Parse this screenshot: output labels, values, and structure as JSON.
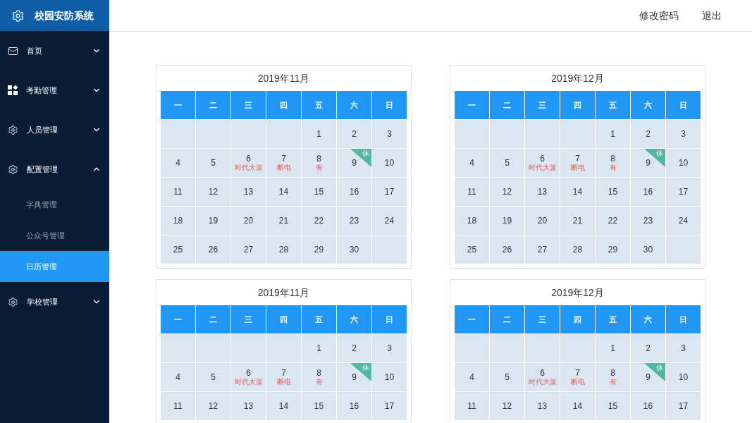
{
  "app": {
    "title": "校园安防系统"
  },
  "header": {
    "links": [
      "修改密码",
      "退出"
    ]
  },
  "sidebar": {
    "items": [
      {
        "label": "首页",
        "expanded": false
      },
      {
        "label": "考勤管理",
        "expanded": false
      },
      {
        "label": "人员管理",
        "expanded": false
      },
      {
        "label": "配置管理",
        "expanded": true,
        "children": [
          {
            "label": "字典管理",
            "selected": false
          },
          {
            "label": "公众号管理",
            "selected": false
          },
          {
            "label": "日历管理",
            "selected": true
          }
        ]
      },
      {
        "label": "学校管理",
        "expanded": false
      }
    ]
  },
  "calendars": [
    {
      "title": "2019年11月",
      "weekdays": [
        "一",
        "二",
        "三",
        "四",
        "五",
        "六",
        "日"
      ],
      "weeks": [
        [
          {
            "kind": "blank"
          },
          {
            "kind": "blank"
          },
          {
            "kind": "blank"
          },
          {
            "kind": "blank"
          },
          {
            "kind": "day",
            "day": "1"
          },
          {
            "kind": "day",
            "day": "2"
          },
          {
            "kind": "day",
            "day": "3"
          }
        ],
        [
          {
            "kind": "day",
            "day": "4"
          },
          {
            "kind": "day",
            "day": "5"
          },
          {
            "kind": "day",
            "day": "6",
            "note": "时代大厦"
          },
          {
            "kind": "day",
            "day": "7",
            "note": "断电"
          },
          {
            "kind": "day",
            "day": "8",
            "note": "有"
          },
          {
            "kind": "day",
            "day": "9",
            "tag": "休"
          },
          {
            "kind": "day",
            "day": "10"
          }
        ],
        [
          {
            "kind": "day",
            "day": "11"
          },
          {
            "kind": "day",
            "day": "12"
          },
          {
            "kind": "day",
            "day": "13"
          },
          {
            "kind": "day",
            "day": "14"
          },
          {
            "kind": "day",
            "day": "15"
          },
          {
            "kind": "day",
            "day": "16"
          },
          {
            "kind": "day",
            "day": "17"
          }
        ],
        [
          {
            "kind": "day",
            "day": "18"
          },
          {
            "kind": "day",
            "day": "19"
          },
          {
            "kind": "day",
            "day": "20"
          },
          {
            "kind": "day",
            "day": "21"
          },
          {
            "kind": "day",
            "day": "22"
          },
          {
            "kind": "day",
            "day": "23"
          },
          {
            "kind": "day",
            "day": "24"
          }
        ],
        [
          {
            "kind": "day",
            "day": "25"
          },
          {
            "kind": "day",
            "day": "26"
          },
          {
            "kind": "day",
            "day": "27"
          },
          {
            "kind": "day",
            "day": "28"
          },
          {
            "kind": "day",
            "day": "29"
          },
          {
            "kind": "day",
            "day": "30"
          },
          {
            "kind": "blank"
          }
        ]
      ]
    },
    {
      "title": "2019年12月",
      "weekdays": [
        "一",
        "二",
        "三",
        "四",
        "五",
        "六",
        "日"
      ],
      "weeks": [
        [
          {
            "kind": "blank"
          },
          {
            "kind": "blank"
          },
          {
            "kind": "blank"
          },
          {
            "kind": "blank"
          },
          {
            "kind": "day",
            "day": "1"
          },
          {
            "kind": "day",
            "day": "2"
          },
          {
            "kind": "day",
            "day": "3"
          }
        ],
        [
          {
            "kind": "day",
            "day": "4"
          },
          {
            "kind": "day",
            "day": "5"
          },
          {
            "kind": "day",
            "day": "6",
            "note": "时代大厦"
          },
          {
            "kind": "day",
            "day": "7",
            "note": "断电"
          },
          {
            "kind": "day",
            "day": "8",
            "note": "有"
          },
          {
            "kind": "day",
            "day": "9",
            "tag": "休"
          },
          {
            "kind": "day",
            "day": "10"
          }
        ],
        [
          {
            "kind": "day",
            "day": "11"
          },
          {
            "kind": "day",
            "day": "12"
          },
          {
            "kind": "day",
            "day": "13"
          },
          {
            "kind": "day",
            "day": "14"
          },
          {
            "kind": "day",
            "day": "15"
          },
          {
            "kind": "day",
            "day": "16"
          },
          {
            "kind": "day",
            "day": "17"
          }
        ],
        [
          {
            "kind": "day",
            "day": "18"
          },
          {
            "kind": "day",
            "day": "19"
          },
          {
            "kind": "day",
            "day": "20"
          },
          {
            "kind": "day",
            "day": "21"
          },
          {
            "kind": "day",
            "day": "22"
          },
          {
            "kind": "day",
            "day": "23"
          },
          {
            "kind": "day",
            "day": "24"
          }
        ],
        [
          {
            "kind": "day",
            "day": "25"
          },
          {
            "kind": "day",
            "day": "26"
          },
          {
            "kind": "day",
            "day": "27"
          },
          {
            "kind": "day",
            "day": "28"
          },
          {
            "kind": "day",
            "day": "29"
          },
          {
            "kind": "day",
            "day": "30"
          },
          {
            "kind": "blank"
          }
        ]
      ]
    },
    {
      "title": "2019年11月",
      "weekdays": [
        "一",
        "二",
        "三",
        "四",
        "五",
        "六",
        "日"
      ],
      "weeks": [
        [
          {
            "kind": "blank"
          },
          {
            "kind": "blank"
          },
          {
            "kind": "blank"
          },
          {
            "kind": "blank"
          },
          {
            "kind": "day",
            "day": "1"
          },
          {
            "kind": "day",
            "day": "2"
          },
          {
            "kind": "day",
            "day": "3"
          }
        ],
        [
          {
            "kind": "day",
            "day": "4"
          },
          {
            "kind": "day",
            "day": "5"
          },
          {
            "kind": "day",
            "day": "6",
            "note": "时代大厦"
          },
          {
            "kind": "day",
            "day": "7",
            "note": "断电"
          },
          {
            "kind": "day",
            "day": "8",
            "note": "有"
          },
          {
            "kind": "day",
            "day": "9",
            "tag": "休"
          },
          {
            "kind": "day",
            "day": "10"
          }
        ],
        [
          {
            "kind": "day",
            "day": "11"
          },
          {
            "kind": "day",
            "day": "12"
          },
          {
            "kind": "day",
            "day": "13"
          },
          {
            "kind": "day",
            "day": "14"
          },
          {
            "kind": "day",
            "day": "15"
          },
          {
            "kind": "day",
            "day": "16"
          },
          {
            "kind": "day",
            "day": "17"
          }
        ]
      ]
    },
    {
      "title": "2019年12月",
      "weekdays": [
        "一",
        "二",
        "三",
        "四",
        "五",
        "六",
        "日"
      ],
      "weeks": [
        [
          {
            "kind": "blank"
          },
          {
            "kind": "blank"
          },
          {
            "kind": "blank"
          },
          {
            "kind": "blank"
          },
          {
            "kind": "day",
            "day": "1"
          },
          {
            "kind": "day",
            "day": "2"
          },
          {
            "kind": "day",
            "day": "3"
          }
        ],
        [
          {
            "kind": "day",
            "day": "4"
          },
          {
            "kind": "day",
            "day": "5"
          },
          {
            "kind": "day",
            "day": "6",
            "note": "时代大厦"
          },
          {
            "kind": "day",
            "day": "7",
            "note": "断电"
          },
          {
            "kind": "day",
            "day": "8",
            "note": "有"
          },
          {
            "kind": "day",
            "day": "9",
            "tag": "休"
          },
          {
            "kind": "day",
            "day": "10"
          }
        ],
        [
          {
            "kind": "day",
            "day": "11"
          },
          {
            "kind": "day",
            "day": "12"
          },
          {
            "kind": "day",
            "day": "13"
          },
          {
            "kind": "day",
            "day": "14"
          },
          {
            "kind": "day",
            "day": "15"
          },
          {
            "kind": "day",
            "day": "16"
          },
          {
            "kind": "day",
            "day": "17"
          }
        ]
      ]
    }
  ]
}
